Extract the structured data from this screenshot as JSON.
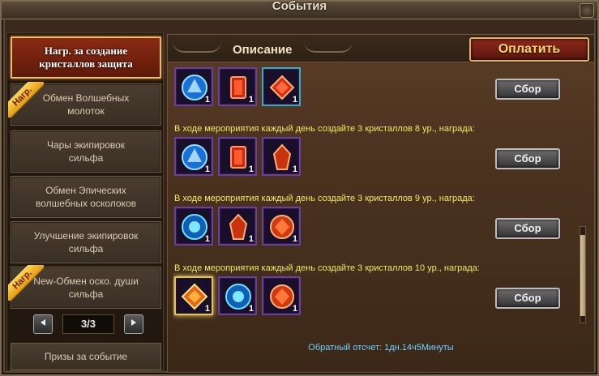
{
  "window": {
    "title": "События"
  },
  "sidebar": {
    "items": [
      {
        "label": "Нагр. за создание\nкристаллов защита",
        "active": true,
        "badge": ""
      },
      {
        "label": "Обмен Волшебных\nмолоток",
        "active": false,
        "badge": "Нагр."
      },
      {
        "label": "Чары экипировок\nсильфа",
        "active": false,
        "badge": ""
      },
      {
        "label": "Обмен Эпических\nволшебных осколоков",
        "active": false,
        "badge": ""
      },
      {
        "label": "Улучшение экипировок\nсильфа",
        "active": false,
        "badge": ""
      },
      {
        "label": "New-Обмен оско. души\nсильфа",
        "active": false,
        "badge": "Нагр."
      }
    ],
    "pager": {
      "count": "3/3",
      "prev_icon": "triangle-left-icon",
      "next_icon": "triangle-right-icon"
    },
    "bottom_label": "Призы за событие"
  },
  "main": {
    "title": "Описание",
    "pay_label": "Оплатить",
    "collect_label": "Сбор",
    "tasks": [
      {
        "desc": "",
        "items": [
          {
            "gem": "blue-rune",
            "qty": "1"
          },
          {
            "gem": "red-crystal",
            "qty": "1"
          },
          {
            "gem": "red-diamond",
            "qty": "1"
          }
        ]
      },
      {
        "desc": "В ходе мероприятия каждый день создайте 3 кристаллов 8 ур., награда:",
        "items": [
          {
            "gem": "blue-rune",
            "qty": "1"
          },
          {
            "gem": "red-crystal",
            "qty": "1"
          },
          {
            "gem": "red-shard",
            "qty": "1"
          }
        ]
      },
      {
        "desc": "В ходе мероприятия каждый день создайте 3 кристаллов 9 ур., награда:",
        "items": [
          {
            "gem": "blue-orb",
            "qty": "1"
          },
          {
            "gem": "red-shard",
            "qty": "1"
          },
          {
            "gem": "red-round",
            "qty": "1"
          }
        ]
      },
      {
        "desc": "В ходе мероприятия каждый день создайте 3 кристаллов 10 ур., награда:",
        "items": [
          {
            "gem": "gold-diamond",
            "qty": "1"
          },
          {
            "gem": "blue-orb",
            "qty": "1"
          },
          {
            "gem": "red-round",
            "qty": "1"
          }
        ]
      }
    ],
    "countdown": "Обратный отсчет: 1дн.14ч5Минуты"
  }
}
